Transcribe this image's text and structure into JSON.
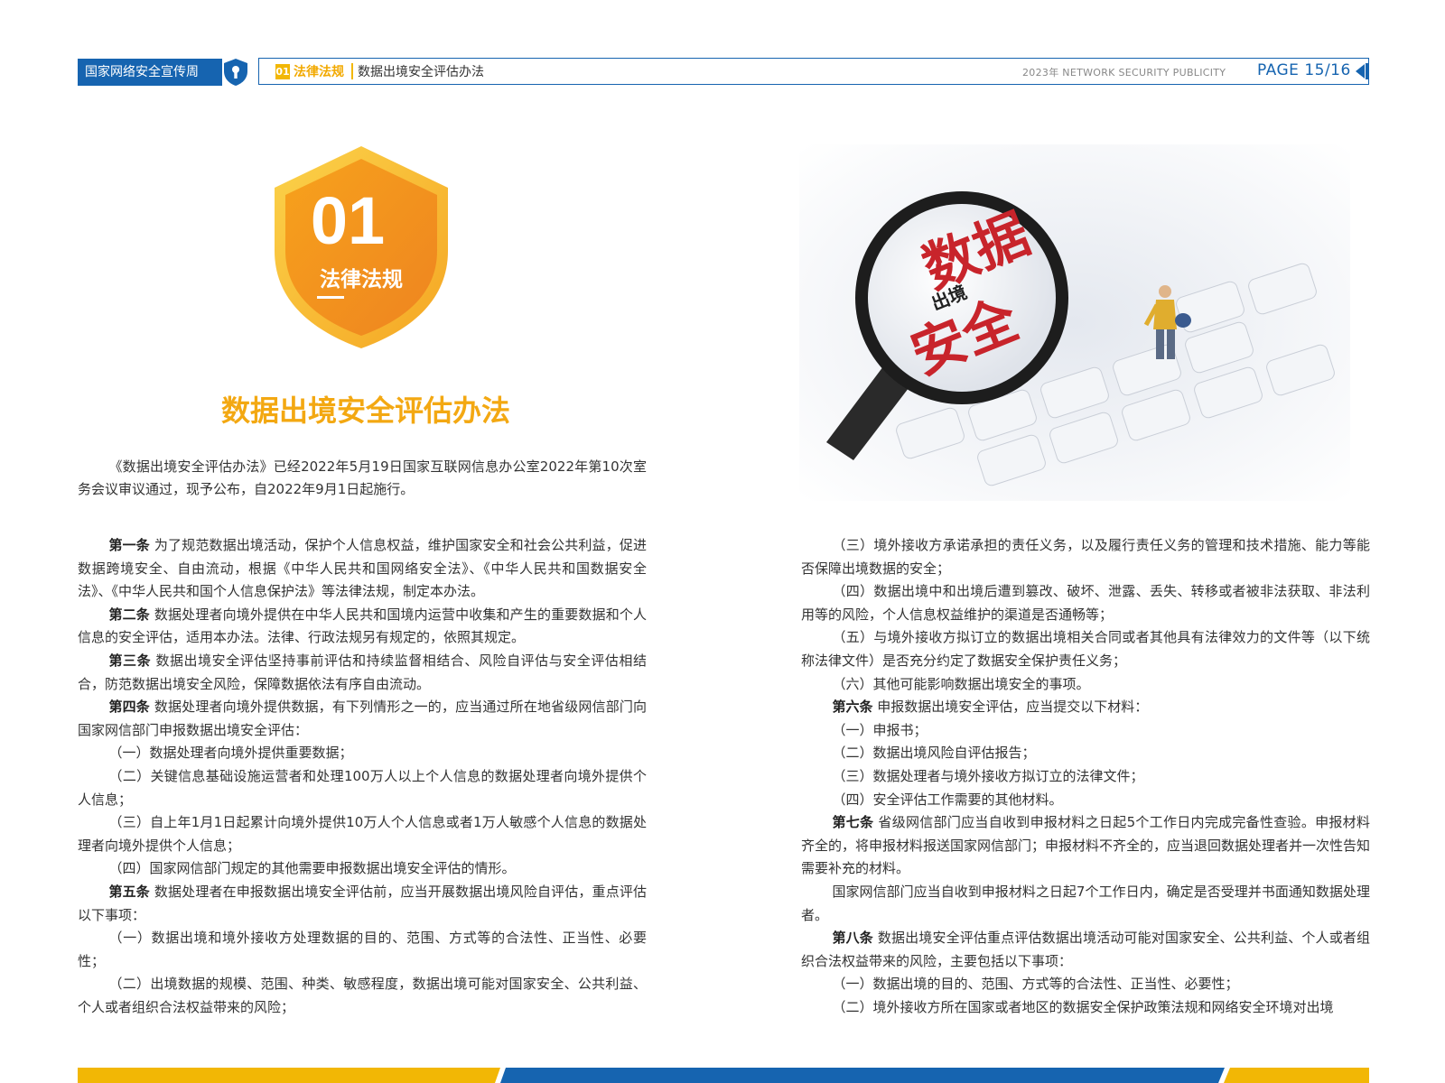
{
  "header": {
    "org_label": "国家网络安全宣传周",
    "section_number": "01",
    "section_label": "法律法规",
    "doc_title": "数据出境安全评估办法",
    "year_tagline": "2023年  NETWORK SECURITY PUBLICITY",
    "page_indicator": "PAGE  15/16"
  },
  "badge": {
    "number": "01",
    "label": "法律法规"
  },
  "photo": {
    "magnifier_text_line1": "数据",
    "magnifier_text_mid": "出境",
    "magnifier_text_line2": "安全"
  },
  "main_title": "数据出境安全评估办法",
  "intro": "《数据出境安全评估办法》已经2022年5月19日国家互联网信息办公室2022年第10次室务会议审议通过，现予公布，自2022年9月1日起施行。",
  "left_column": [
    {
      "head": "第一条",
      "text": "为了规范数据出境活动，保护个人信息权益，维护国家安全和社会公共利益，促进数据跨境安全、自由流动，根据《中华人民共和国网络安全法》、《中华人民共和国数据安全法》、《中华人民共和国个人信息保护法》等法律法规，制定本办法。"
    },
    {
      "head": "第二条",
      "text": "数据处理者向境外提供在中华人民共和国境内运营中收集和产生的重要数据和个人信息的安全评估，适用本办法。法律、行政法规另有规定的，依照其规定。"
    },
    {
      "head": "第三条",
      "text": "数据出境安全评估坚持事前评估和持续监督相结合、风险自评估与安全评估相结合，防范数据出境安全风险，保障数据依法有序自由流动。"
    },
    {
      "head": "第四条",
      "text": "数据处理者向境外提供数据，有下列情形之一的，应当通过所在地省级网信部门向国家网信部门申报数据出境安全评估："
    },
    {
      "head": "",
      "text": "（一）数据处理者向境外提供重要数据；"
    },
    {
      "head": "",
      "text": "（二）关键信息基础设施运营者和处理100万人以上个人信息的数据处理者向境外提供个人信息；"
    },
    {
      "head": "",
      "text": "（三）自上年1月1日起累计向境外提供10万人个人信息或者1万人敏感个人信息的数据处理者向境外提供个人信息；"
    },
    {
      "head": "",
      "text": "（四）国家网信部门规定的其他需要申报数据出境安全评估的情形。"
    },
    {
      "head": "第五条",
      "text": "数据处理者在申报数据出境安全评估前，应当开展数据出境风险自评估，重点评估以下事项："
    },
    {
      "head": "",
      "text": "（一）数据出境和境外接收方处理数据的目的、范围、方式等的合法性、正当性、必要性；"
    },
    {
      "head": "",
      "text": "（二）出境数据的规模、范围、种类、敏感程度，数据出境可能对国家安全、公共利益、个人或者组织合法权益带来的风险；"
    }
  ],
  "right_column": [
    {
      "head": "",
      "text": "（三）境外接收方承诺承担的责任义务，以及履行责任义务的管理和技术措施、能力等能否保障出境数据的安全；"
    },
    {
      "head": "",
      "text": "（四）数据出境中和出境后遭到篡改、破坏、泄露、丢失、转移或者被非法获取、非法利用等的风险，个人信息权益维护的渠道是否通畅等；"
    },
    {
      "head": "",
      "text": "（五）与境外接收方拟订立的数据出境相关合同或者其他具有法律效力的文件等（以下统称法律文件）是否充分约定了数据安全保护责任义务；"
    },
    {
      "head": "",
      "text": "（六）其他可能影响数据出境安全的事项。"
    },
    {
      "head": "第六条",
      "text": "申报数据出境安全评估，应当提交以下材料："
    },
    {
      "head": "",
      "text": "（一）申报书；"
    },
    {
      "head": "",
      "text": "（二）数据出境风险自评估报告；"
    },
    {
      "head": "",
      "text": "（三）数据处理者与境外接收方拟订立的法律文件；"
    },
    {
      "head": "",
      "text": "（四）安全评估工作需要的其他材料。"
    },
    {
      "head": "第七条",
      "text": "省级网信部门应当自收到申报材料之日起5个工作日内完成完备性查验。申报材料齐全的，将申报材料报送国家网信部门；申报材料不齐全的，应当退回数据处理者并一次性告知需要补充的材料。"
    },
    {
      "head": "",
      "text": "国家网信部门应当自收到申报材料之日起7个工作日内，确定是否受理并书面通知数据处理者。"
    },
    {
      "head": "第八条",
      "text": "数据出境安全评估重点评估数据出境活动可能对国家安全、公共利益、个人或者组织合法权益带来的风险，主要包括以下事项："
    },
    {
      "head": "",
      "text": "（一）数据出境的目的、范围、方式等的合法性、正当性、必要性；"
    },
    {
      "head": "",
      "text": "（二）境外接收方所在国家或者地区的数据安全保护政策法规和网络安全环境对出境"
    }
  ],
  "colors": {
    "brand_blue": "#1664b0",
    "accent_orange": "#f3a812",
    "accent_yellow": "#f2b705"
  }
}
